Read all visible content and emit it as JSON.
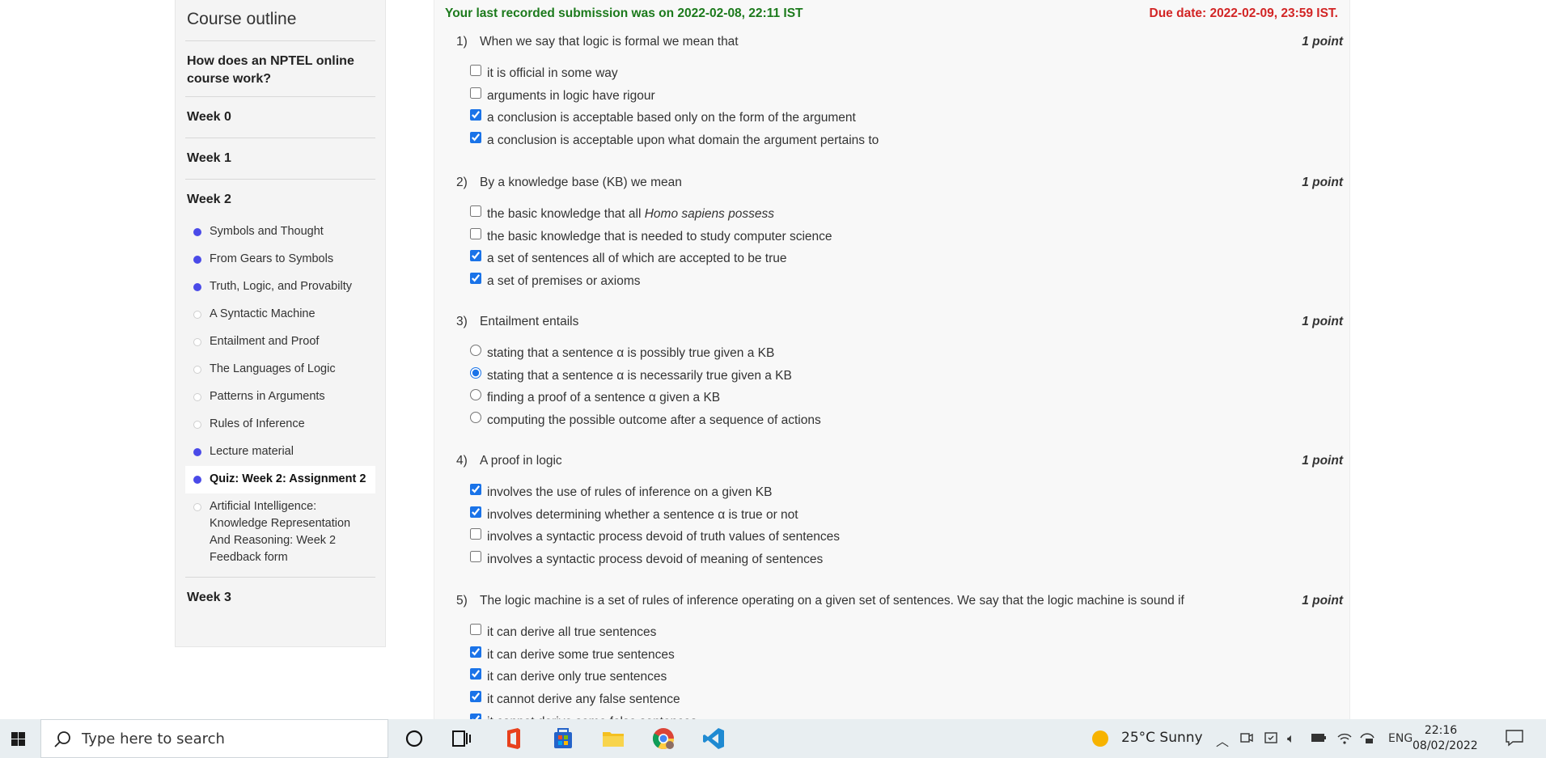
{
  "sidebar": {
    "title": "Course outline",
    "units": [
      {
        "label": "How does an NPTEL online course work?"
      },
      {
        "label": "Week 0"
      },
      {
        "label": "Week 1"
      },
      {
        "label": "Week 2"
      }
    ],
    "lessons": [
      {
        "label": "Symbols and Thought",
        "status": "done"
      },
      {
        "label": "From Gears to Symbols",
        "status": "done"
      },
      {
        "label": "Truth, Logic, and Provabilty",
        "status": "done"
      },
      {
        "label": "A Syntactic Machine",
        "status": "todo"
      },
      {
        "label": "Entailment and Proof",
        "status": "todo"
      },
      {
        "label": "The Languages of Logic",
        "status": "todo"
      },
      {
        "label": "Patterns in Arguments",
        "status": "todo"
      },
      {
        "label": "Rules of Inference",
        "status": "todo"
      },
      {
        "label": "Lecture material",
        "status": "done"
      },
      {
        "label": "Quiz: Week 2: Assignment 2",
        "status": "done"
      },
      {
        "label": "Artificial Intelligence: Knowledge Representation And Reasoning: Week 2 Feedback form",
        "status": "todo"
      }
    ],
    "week3": "Week 3"
  },
  "content": {
    "submission": "Your last recorded submission was on 2022-02-08, 22:11 IST",
    "due": "Due date: 2022-02-09, 23:59 IST.",
    "questions": [
      {
        "num": "1)",
        "text": "When we say that logic is formal we mean that",
        "point": "1 point",
        "type": "checkbox",
        "options": [
          {
            "label": "it is official in some way",
            "checked": false
          },
          {
            "label": "arguments in logic have rigour",
            "checked": false
          },
          {
            "label": "a conclusion is acceptable based only on the form of the argument",
            "checked": true
          },
          {
            "label": "a conclusion is acceptable upon what domain the argument pertains to",
            "checked": true
          }
        ]
      },
      {
        "num": "2)",
        "text": "By a knowledge base (KB) we mean",
        "point": "1 point",
        "type": "checkbox",
        "options": [
          {
            "label": "the basic knowledge that all ",
            "italic": "Homo sapiens possess",
            "checked": false
          },
          {
            "label": "the basic knowledge that is needed to study computer science",
            "checked": false
          },
          {
            "label": "a set of sentences all of which are accepted to be true",
            "checked": true
          },
          {
            "label": "a set of premises or axioms",
            "checked": true
          }
        ]
      },
      {
        "num": "3)",
        "text": "Entailment entails",
        "point": "1 point",
        "type": "radio",
        "options": [
          {
            "label": "stating that a sentence α is possibly true given a KB",
            "checked": false
          },
          {
            "label": "stating that a sentence α is necessarily true given a KB",
            "checked": true
          },
          {
            "label": "finding a proof of a sentence α given a KB",
            "checked": false
          },
          {
            "label": "computing the possible outcome after a sequence of actions",
            "checked": false
          }
        ]
      },
      {
        "num": "4)",
        "text": "A proof in logic",
        "point": "1 point",
        "type": "checkbox",
        "options": [
          {
            "label": "involves the use of rules of inference on a given KB",
            "checked": true
          },
          {
            "label": "involves determining whether a sentence α is true or not",
            "checked": true
          },
          {
            "label": "involves a syntactic process devoid of truth values of sentences",
            "checked": false
          },
          {
            "label": "involves a syntactic process devoid of meaning of sentences",
            "checked": false
          }
        ]
      },
      {
        "num": "5)",
        "text": "The logic machine is a set of rules of inference operating on a given set of sentences. We say that the logic machine is sound if",
        "point": "1 point",
        "type": "checkbox",
        "options": [
          {
            "label": "it can derive all true sentences",
            "checked": false
          },
          {
            "label": "it can derive some true sentences",
            "checked": true
          },
          {
            "label": "it can derive only true sentences",
            "checked": true
          },
          {
            "label": "it cannot derive any false sentence",
            "checked": true
          },
          {
            "label": "it cannot derive some false sentences",
            "checked": true
          }
        ]
      }
    ]
  },
  "taskbar": {
    "search_placeholder": "Type here to search",
    "weather": "25°C  Sunny",
    "language": "ENG",
    "time": "22:16",
    "date": "08/02/2022",
    "icons": [
      "cortana-icon",
      "task-view-icon",
      "office-icon",
      "store-icon",
      "file-explorer-icon",
      "chrome-icon",
      "vscode-icon"
    ]
  }
}
